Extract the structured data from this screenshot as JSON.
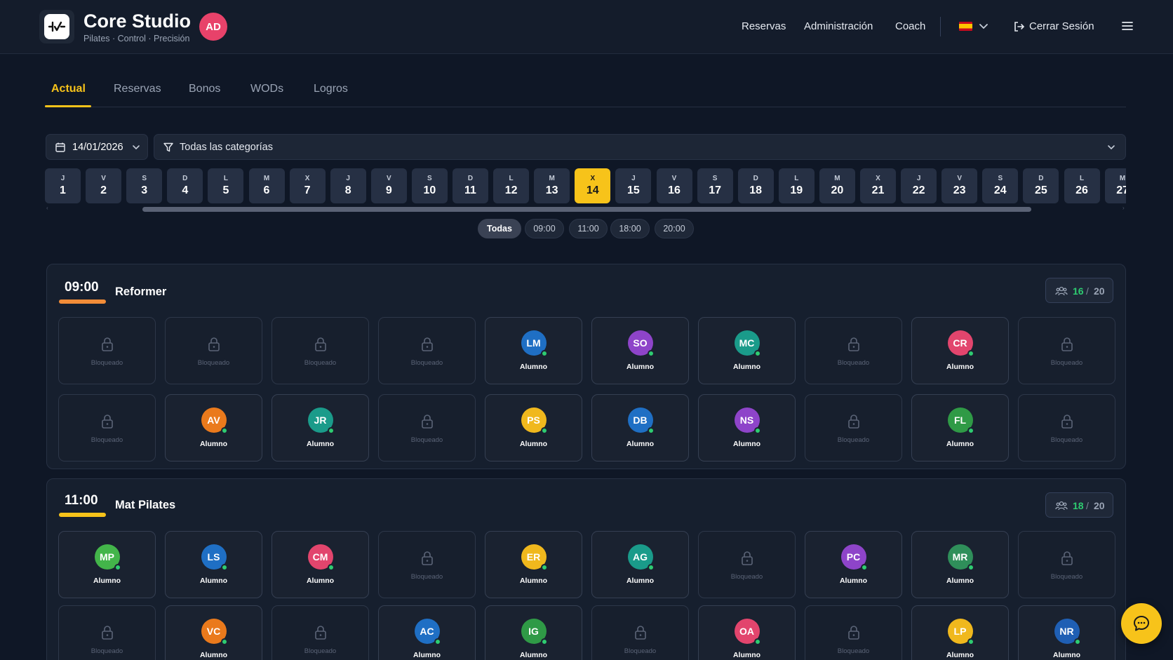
{
  "brand": {
    "title": "Core Studio",
    "subtitle": "Pilates · Control · Precisión",
    "user_initials": "AD",
    "user_color": "#e8426a"
  },
  "nav": {
    "reservas": "Reservas",
    "admin": "Administración",
    "coach": "Coach",
    "language_flag": "es-flag",
    "logout": "Cerrar Sesión"
  },
  "tabs": [
    {
      "label": "Actual",
      "active": true
    },
    {
      "label": "Reservas",
      "active": false
    },
    {
      "label": "Bonos",
      "active": false
    },
    {
      "label": "WODs",
      "active": false
    },
    {
      "label": "Logros",
      "active": false
    }
  ],
  "filters": {
    "date": "14/01/2026",
    "category": "Todas las categorías"
  },
  "days": [
    {
      "l": "J",
      "n": "1"
    },
    {
      "l": "V",
      "n": "2"
    },
    {
      "l": "S",
      "n": "3"
    },
    {
      "l": "D",
      "n": "4"
    },
    {
      "l": "L",
      "n": "5"
    },
    {
      "l": "M",
      "n": "6"
    },
    {
      "l": "X",
      "n": "7"
    },
    {
      "l": "J",
      "n": "8"
    },
    {
      "l": "V",
      "n": "9"
    },
    {
      "l": "S",
      "n": "10"
    },
    {
      "l": "D",
      "n": "11"
    },
    {
      "l": "L",
      "n": "12"
    },
    {
      "l": "M",
      "n": "13"
    },
    {
      "l": "X",
      "n": "14",
      "selected": true
    },
    {
      "l": "J",
      "n": "15"
    },
    {
      "l": "V",
      "n": "16"
    },
    {
      "l": "S",
      "n": "17"
    },
    {
      "l": "D",
      "n": "18"
    },
    {
      "l": "L",
      "n": "19"
    },
    {
      "l": "M",
      "n": "20"
    },
    {
      "l": "X",
      "n": "21"
    },
    {
      "l": "J",
      "n": "22"
    },
    {
      "l": "V",
      "n": "23"
    },
    {
      "l": "S",
      "n": "24"
    },
    {
      "l": "D",
      "n": "25"
    },
    {
      "l": "L",
      "n": "26"
    },
    {
      "l": "M",
      "n": "27"
    }
  ],
  "time_filters": [
    {
      "label": "Todas",
      "active": true
    },
    {
      "label": "09:00"
    },
    {
      "label": "11:00"
    },
    {
      "label": "18:00"
    },
    {
      "label": "20:00"
    }
  ],
  "labels": {
    "locked": "Bloqueado",
    "student": "Alumno",
    "count_sep": "/"
  },
  "sessions": [
    {
      "time": "09:00",
      "name": "Reformer",
      "accent": "#f28c38",
      "booked": "16",
      "capacity": "20",
      "slots": [
        null,
        null,
        null,
        null,
        {
          "i": "LM",
          "c": "#1f6fc4"
        },
        {
          "i": "SO",
          "c": "#8e44c9"
        },
        {
          "i": "MC",
          "c": "#1a9b8a"
        },
        null,
        {
          "i": "CR",
          "c": "#e2456d"
        },
        null,
        null,
        {
          "i": "AV",
          "c": "#ea7a1c"
        },
        {
          "i": "JR",
          "c": "#1a9b8a"
        },
        null,
        {
          "i": "PS",
          "c": "#f0b81d"
        },
        {
          "i": "DB",
          "c": "#1f6fc4"
        },
        {
          "i": "NS",
          "c": "#8e44c9"
        },
        null,
        {
          "i": "FL",
          "c": "#2f9a46"
        },
        null
      ]
    },
    {
      "time": "11:00",
      "name": "Mat Pilates",
      "accent": "#f7c31a",
      "booked": "18",
      "capacity": "20",
      "slots": [
        {
          "i": "MP",
          "c": "#43b54a"
        },
        {
          "i": "LS",
          "c": "#1f6fc4"
        },
        {
          "i": "CM",
          "c": "#e2456d"
        },
        null,
        {
          "i": "ER",
          "c": "#f0b81d"
        },
        {
          "i": "AG",
          "c": "#1a9b8a"
        },
        null,
        {
          "i": "PC",
          "c": "#8e44c9"
        },
        {
          "i": "MR",
          "c": "#2f8f5a"
        },
        null,
        null,
        {
          "i": "VC",
          "c": "#ea7a1c"
        },
        null,
        {
          "i": "AC",
          "c": "#1f6fc4"
        },
        {
          "i": "IG",
          "c": "#2f9a46"
        },
        null,
        {
          "i": "OA",
          "c": "#e2456d"
        },
        null,
        {
          "i": "LP",
          "c": "#f0b81d"
        },
        {
          "i": "NR",
          "c": "#1f5fb4"
        }
      ]
    }
  ]
}
